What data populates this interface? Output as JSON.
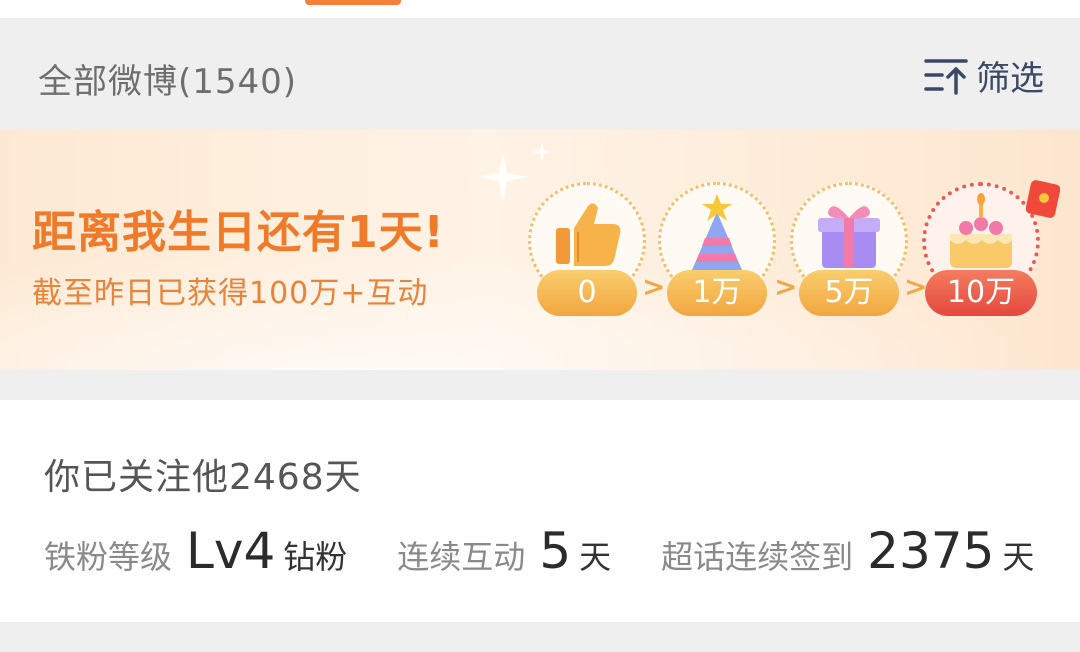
{
  "header": {
    "all_posts_label": "全部微博(1540)",
    "filter_label": "筛选",
    "filter_icon": "sort-filter-icon"
  },
  "birthday_banner": {
    "title": "距离我生日还有1天!",
    "subtitle": "截至昨日已获得100万+互动",
    "milestones": [
      {
        "label": "0",
        "icon": "thumbs-up-icon"
      },
      {
        "label": "1万",
        "icon": "party-hat-icon"
      },
      {
        "label": "5万",
        "icon": "gift-box-icon"
      },
      {
        "label": "10万",
        "icon": "birthday-cake-icon"
      }
    ],
    "separator": ">",
    "colors": {
      "accent": "#ee7a2a",
      "final": "#e4483d",
      "pill": "#f2a640"
    }
  },
  "follow_card": {
    "follow_days": "你已关注他2468天",
    "fan_level_label": "铁粉等级",
    "fan_level_value": "Lv4",
    "fan_level_tier": "钻粉",
    "interaction_label": "连续互动",
    "interaction_value": "5",
    "interaction_unit": "天",
    "checkin_label": "超话连续签到",
    "checkin_value": "2375",
    "checkin_unit": "天"
  }
}
